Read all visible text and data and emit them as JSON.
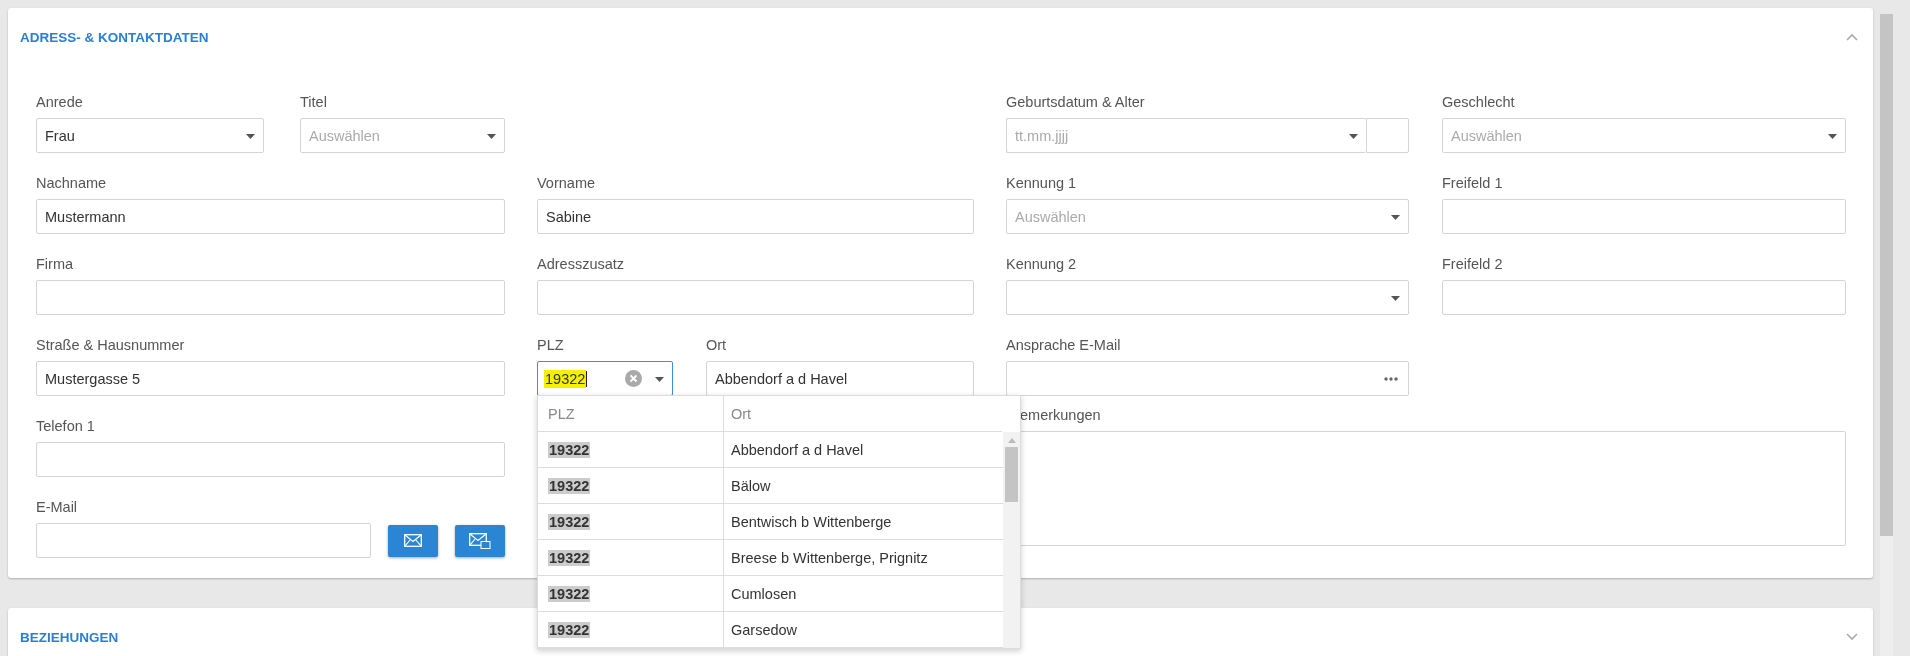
{
  "sections": [
    {
      "title": "ADRESS- & KONTAKTDATEN",
      "expanded": true
    },
    {
      "title": "BEZIEHUNGEN",
      "expanded": false
    }
  ],
  "left_rows": [
    [
      {
        "kind": "pair",
        "fields": [
          {
            "kind": "select",
            "label": "Anrede",
            "value": "Frau"
          },
          {
            "kind": "select",
            "label": "Titel",
            "placeholder": "Auswählen"
          }
        ]
      }
    ],
    [
      {
        "kind": "text",
        "label": "Nachname",
        "value": "Mustermann"
      },
      {
        "kind": "text",
        "label": "Vorname",
        "value": "Sabine"
      }
    ],
    [
      {
        "kind": "text",
        "label": "Firma"
      },
      {
        "kind": "text",
        "label": "Adresszusatz"
      }
    ],
    [
      {
        "kind": "text",
        "label": "Straße & Hausnummer",
        "value": "Mustergasse 5"
      },
      {
        "kind": "pair",
        "fields": [
          {
            "kind": "zip",
            "label": "PLZ",
            "value": "19322"
          },
          {
            "kind": "text",
            "label": "Ort",
            "value": "Abbendorf a d Havel"
          }
        ]
      }
    ],
    [
      {
        "kind": "text",
        "label": "Telefon 1"
      }
    ],
    [
      {
        "kind": "email",
        "label": "E-Mail"
      }
    ]
  ],
  "right_rows": [
    [
      {
        "kind": "date",
        "label": "Geburtsdatum & Alter",
        "placeholder": "tt.mm.jjjj"
      },
      {
        "kind": "select",
        "label": "Geschlecht",
        "placeholder": "Auswählen"
      }
    ],
    [
      {
        "kind": "select",
        "label": "Kennung 1",
        "placeholder": "Auswählen"
      },
      {
        "kind": "text",
        "label": "Freifeld 1"
      }
    ],
    [
      {
        "kind": "select",
        "label": "Kennung 2"
      },
      {
        "kind": "text",
        "label": "Freifeld 2"
      }
    ],
    [
      {
        "kind": "ellipsis",
        "label": "Ansprache E-Mail"
      }
    ],
    [
      {
        "kind": "textarea",
        "label": "emerkungen"
      }
    ]
  ],
  "zip_dropdown": {
    "columns": [
      "PLZ",
      "Ort"
    ],
    "rows": [
      {
        "plz": "19322",
        "ort": "Abbendorf a d Havel"
      },
      {
        "plz": "19322",
        "ort": "Bälow"
      },
      {
        "plz": "19322",
        "ort": "Bentwisch b Wittenberge"
      },
      {
        "plz": "19322",
        "ort": "Breese b Wittenberge, Prignitz"
      },
      {
        "plz": "19322",
        "ort": "Cumlosen"
      },
      {
        "plz": "19322",
        "ort": "Garsedow"
      }
    ]
  }
}
